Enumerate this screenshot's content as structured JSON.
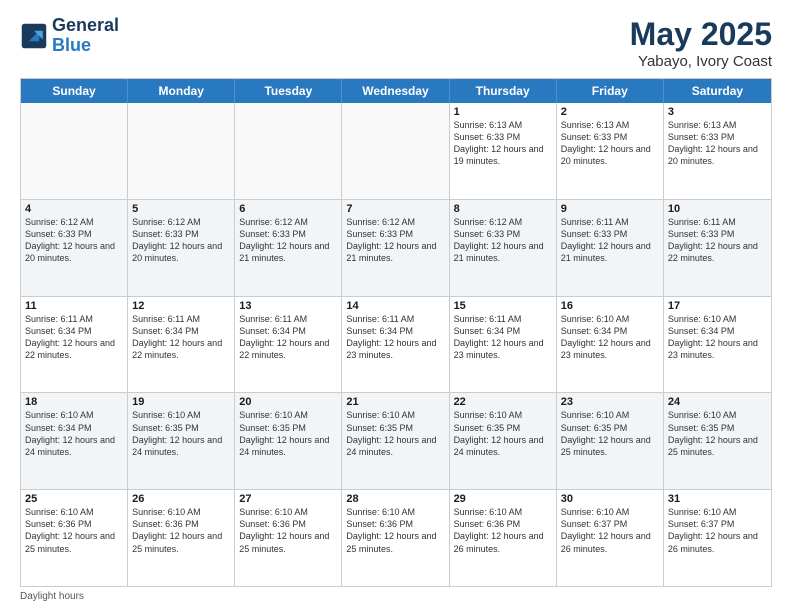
{
  "header": {
    "logo": {
      "line1": "General",
      "line2": "Blue"
    },
    "month": "May 2025",
    "location": "Yabayo, Ivory Coast"
  },
  "days_of_week": [
    "Sunday",
    "Monday",
    "Tuesday",
    "Wednesday",
    "Thursday",
    "Friday",
    "Saturday"
  ],
  "weeks": [
    [
      {
        "day": "",
        "info": "",
        "empty": true
      },
      {
        "day": "",
        "info": "",
        "empty": true
      },
      {
        "day": "",
        "info": "",
        "empty": true
      },
      {
        "day": "",
        "info": "",
        "empty": true
      },
      {
        "day": "1",
        "info": "Sunrise: 6:13 AM\nSunset: 6:33 PM\nDaylight: 12 hours\nand 19 minutes.",
        "empty": false
      },
      {
        "day": "2",
        "info": "Sunrise: 6:13 AM\nSunset: 6:33 PM\nDaylight: 12 hours\nand 20 minutes.",
        "empty": false
      },
      {
        "day": "3",
        "info": "Sunrise: 6:13 AM\nSunset: 6:33 PM\nDaylight: 12 hours\nand 20 minutes.",
        "empty": false
      }
    ],
    [
      {
        "day": "4",
        "info": "Sunrise: 6:12 AM\nSunset: 6:33 PM\nDaylight: 12 hours\nand 20 minutes.",
        "empty": false
      },
      {
        "day": "5",
        "info": "Sunrise: 6:12 AM\nSunset: 6:33 PM\nDaylight: 12 hours\nand 20 minutes.",
        "empty": false
      },
      {
        "day": "6",
        "info": "Sunrise: 6:12 AM\nSunset: 6:33 PM\nDaylight: 12 hours\nand 21 minutes.",
        "empty": false
      },
      {
        "day": "7",
        "info": "Sunrise: 6:12 AM\nSunset: 6:33 PM\nDaylight: 12 hours\nand 21 minutes.",
        "empty": false
      },
      {
        "day": "8",
        "info": "Sunrise: 6:12 AM\nSunset: 6:33 PM\nDaylight: 12 hours\nand 21 minutes.",
        "empty": false
      },
      {
        "day": "9",
        "info": "Sunrise: 6:11 AM\nSunset: 6:33 PM\nDaylight: 12 hours\nand 21 minutes.",
        "empty": false
      },
      {
        "day": "10",
        "info": "Sunrise: 6:11 AM\nSunset: 6:33 PM\nDaylight: 12 hours\nand 22 minutes.",
        "empty": false
      }
    ],
    [
      {
        "day": "11",
        "info": "Sunrise: 6:11 AM\nSunset: 6:34 PM\nDaylight: 12 hours\nand 22 minutes.",
        "empty": false
      },
      {
        "day": "12",
        "info": "Sunrise: 6:11 AM\nSunset: 6:34 PM\nDaylight: 12 hours\nand 22 minutes.",
        "empty": false
      },
      {
        "day": "13",
        "info": "Sunrise: 6:11 AM\nSunset: 6:34 PM\nDaylight: 12 hours\nand 22 minutes.",
        "empty": false
      },
      {
        "day": "14",
        "info": "Sunrise: 6:11 AM\nSunset: 6:34 PM\nDaylight: 12 hours\nand 23 minutes.",
        "empty": false
      },
      {
        "day": "15",
        "info": "Sunrise: 6:11 AM\nSunset: 6:34 PM\nDaylight: 12 hours\nand 23 minutes.",
        "empty": false
      },
      {
        "day": "16",
        "info": "Sunrise: 6:10 AM\nSunset: 6:34 PM\nDaylight: 12 hours\nand 23 minutes.",
        "empty": false
      },
      {
        "day": "17",
        "info": "Sunrise: 6:10 AM\nSunset: 6:34 PM\nDaylight: 12 hours\nand 23 minutes.",
        "empty": false
      }
    ],
    [
      {
        "day": "18",
        "info": "Sunrise: 6:10 AM\nSunset: 6:34 PM\nDaylight: 12 hours\nand 24 minutes.",
        "empty": false
      },
      {
        "day": "19",
        "info": "Sunrise: 6:10 AM\nSunset: 6:35 PM\nDaylight: 12 hours\nand 24 minutes.",
        "empty": false
      },
      {
        "day": "20",
        "info": "Sunrise: 6:10 AM\nSunset: 6:35 PM\nDaylight: 12 hours\nand 24 minutes.",
        "empty": false
      },
      {
        "day": "21",
        "info": "Sunrise: 6:10 AM\nSunset: 6:35 PM\nDaylight: 12 hours\nand 24 minutes.",
        "empty": false
      },
      {
        "day": "22",
        "info": "Sunrise: 6:10 AM\nSunset: 6:35 PM\nDaylight: 12 hours\nand 24 minutes.",
        "empty": false
      },
      {
        "day": "23",
        "info": "Sunrise: 6:10 AM\nSunset: 6:35 PM\nDaylight: 12 hours\nand 25 minutes.",
        "empty": false
      },
      {
        "day": "24",
        "info": "Sunrise: 6:10 AM\nSunset: 6:35 PM\nDaylight: 12 hours\nand 25 minutes.",
        "empty": false
      }
    ],
    [
      {
        "day": "25",
        "info": "Sunrise: 6:10 AM\nSunset: 6:36 PM\nDaylight: 12 hours\nand 25 minutes.",
        "empty": false
      },
      {
        "day": "26",
        "info": "Sunrise: 6:10 AM\nSunset: 6:36 PM\nDaylight: 12 hours\nand 25 minutes.",
        "empty": false
      },
      {
        "day": "27",
        "info": "Sunrise: 6:10 AM\nSunset: 6:36 PM\nDaylight: 12 hours\nand 25 minutes.",
        "empty": false
      },
      {
        "day": "28",
        "info": "Sunrise: 6:10 AM\nSunset: 6:36 PM\nDaylight: 12 hours\nand 25 minutes.",
        "empty": false
      },
      {
        "day": "29",
        "info": "Sunrise: 6:10 AM\nSunset: 6:36 PM\nDaylight: 12 hours\nand 26 minutes.",
        "empty": false
      },
      {
        "day": "30",
        "info": "Sunrise: 6:10 AM\nSunset: 6:37 PM\nDaylight: 12 hours\nand 26 minutes.",
        "empty": false
      },
      {
        "day": "31",
        "info": "Sunrise: 6:10 AM\nSunset: 6:37 PM\nDaylight: 12 hours\nand 26 minutes.",
        "empty": false
      }
    ]
  ],
  "footer": "Daylight hours"
}
